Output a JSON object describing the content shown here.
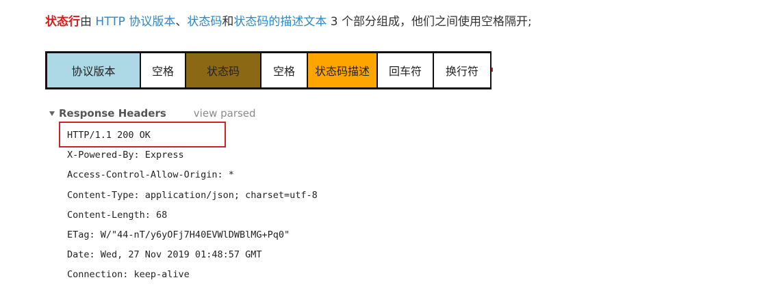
{
  "intro": {
    "term_status_line": "状态行",
    "text_by": "由 ",
    "link_http_version": "HTTP 协议版本",
    "separator_comma": "、",
    "link_status_code": "状态码",
    "text_and": "和",
    "link_status_text": "状态码的描述文本",
    "text_rest": " 3 个部分组成，他们之间使用空格隔开;"
  },
  "diagram": {
    "cells": [
      {
        "label": "协议版本",
        "color": "#add8e6"
      },
      {
        "label": "空格",
        "color": "#ffffff"
      },
      {
        "label": "状态码",
        "color": "#8b6914"
      },
      {
        "label": "空格",
        "color": "#ffffff"
      },
      {
        "label": "状态码描述",
        "color": "#ffa500"
      },
      {
        "label": "回车符",
        "color": "#ffffff"
      },
      {
        "label": "换行符",
        "color": "#ffffff"
      }
    ]
  },
  "response_headers": {
    "title": "Response Headers",
    "view_parsed_label": "view parsed",
    "lines": [
      "HTTP/1.1 200 OK",
      "X-Powered-By: Express",
      "Access-Control-Allow-Origin: *",
      "Content-Type: application/json; charset=utf-8",
      "Content-Length: 68",
      "ETag: W/\"44-nT/y6yOFj7H40EVWlDWBlMG+Pq0\"",
      "Date: Wed, 27 Nov 2019 01:48:57 GMT",
      "Connection: keep-alive"
    ]
  },
  "colors": {
    "status_line_term": "#d91a1a",
    "link": "#2b87c8",
    "highlight_border": "#cc2222"
  }
}
